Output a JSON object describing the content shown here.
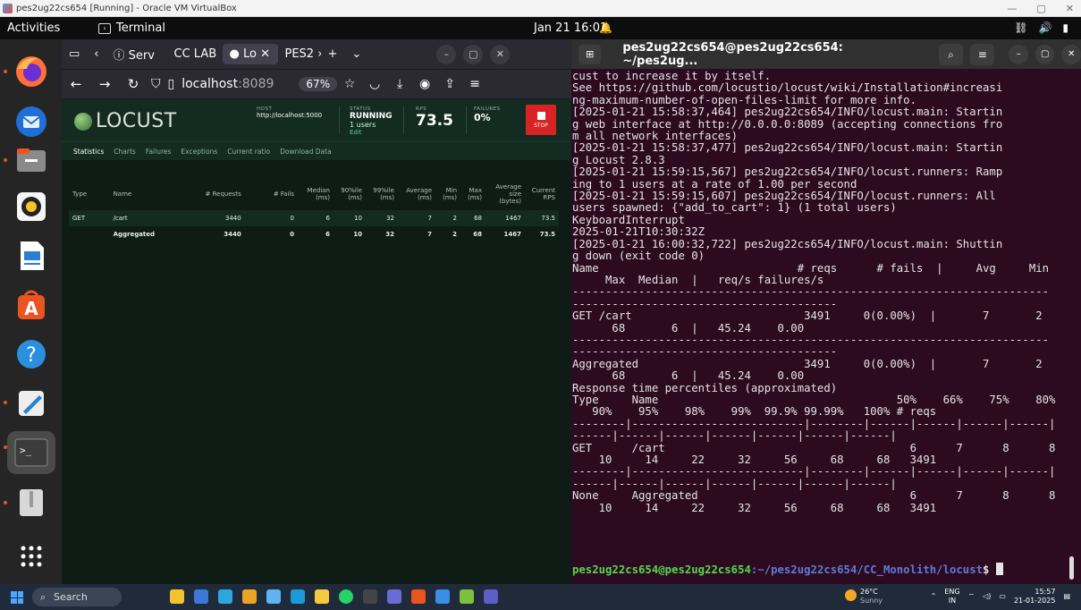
{
  "vbox": {
    "title": "pes2ug22cs654 [Running] - Oracle VM VirtualBox",
    "controls": [
      "—",
      "▢",
      "✕"
    ]
  },
  "topbar": {
    "activities": "Activities",
    "app": "Terminal",
    "clock": "Jan 21  16:01"
  },
  "firefox": {
    "tabs": [
      "Serv",
      "CC LAB",
      "Lo",
      "PES2"
    ],
    "url_host": "localhost",
    "url_port": ":8089",
    "zoom": "67%"
  },
  "locust": {
    "logo": "LOCUST",
    "host_label": "HOST",
    "host": "http://localhost:5000",
    "status_label": "STATUS",
    "status": "RUNNING",
    "users": "1 users",
    "edit": "Edit",
    "rps_label": "RPS",
    "rps": "73.5",
    "failures_label": "FAILURES",
    "failures": "0%",
    "stop": "STOP",
    "nav": [
      "Statistics",
      "Charts",
      "Failures",
      "Exceptions",
      "Current ratio",
      "Download Data"
    ],
    "columns": [
      "Type",
      "Name",
      "# Requests",
      "# Fails",
      "Median (ms)",
      "90%ile (ms)",
      "99%ile (ms)",
      "Average (ms)",
      "Min (ms)",
      "Max (ms)",
      "Average size (bytes)",
      "Current RPS"
    ],
    "rows": [
      [
        "GET",
        "/cart",
        "3440",
        "0",
        "6",
        "10",
        "32",
        "7",
        "2",
        "68",
        "1467",
        "73.5"
      ],
      [
        "",
        "Aggregated",
        "3440",
        "0",
        "6",
        "10",
        "32",
        "7",
        "2",
        "68",
        "1467",
        "73.5"
      ]
    ]
  },
  "terminal": {
    "title": "pes2ug22cs654@pes2ug22cs654: ~/pes2ug...",
    "lines": [
      "cust to increase it by itself.",
      "See https://github.com/locustio/locust/wiki/Installation#increasi",
      "ng-maximum-number-of-open-files-limit for more info.",
      "[2025-01-21 15:58:37,464] pes2ug22cs654/INFO/locust.main: Startin",
      "g web interface at http://0.0.0.0:8089 (accepting connections fro",
      "m all network interfaces)",
      "[2025-01-21 15:58:37,477] pes2ug22cs654/INFO/locust.main: Startin",
      "g Locust 2.8.3",
      "[2025-01-21 15:59:15,567] pes2ug22cs654/INFO/locust.runners: Ramp",
      "ing to 1 users at a rate of 1.00 per second",
      "[2025-01-21 15:59:15,607] pes2ug22cs654/INFO/locust.runners: All",
      "users spawned: {\"add_to_cart\": 1} (1 total users)",
      "KeyboardInterrupt",
      "2025-01-21T10:30:32Z",
      "[2025-01-21 16:00:32,722] pes2ug22cs654/INFO/locust.main: Shuttin",
      "g down (exit code 0)",
      "Name                              # reqs      # fails  |     Avg     Min",
      "     Max  Median  |   req/s failures/s",
      "------------------------------------------------------------------------",
      "----------------------------------------",
      "GET /cart                          3491     0(0.00%)  |       7       2",
      "      68       6  |   45.24    0.00",
      "------------------------------------------------------------------------",
      "----------------------------------------",
      "Aggregated                         3491     0(0.00%)  |       7       2",
      "      68       6  |   45.24    0.00",
      "",
      "Response time percentiles (approximated)",
      "Type     Name                                    50%    66%    75%    80%",
      "   90%    95%    98%    99%  99.9% 99.99%   100% # reqs",
      "--------|--------------------------|--------|------|------|------|------|",
      "------|------|------|------|------|------|------|",
      "GET      /cart                                     6      7      8      8",
      "    10     14     22     32     56     68     68   3491",
      "--------|--------------------------|--------|------|------|------|------|",
      "------|------|------|------|------|------|------|",
      "None     Aggregated                                6      7      8      8",
      "    10     14     22     32     56     68     68   3491"
    ],
    "prompt_user": "pes2ug22cs654@pes2ug22cs654",
    "prompt_path": ":~/pes2ug22cs654/CC_Monolith/locust",
    "prompt_sym": "$ "
  },
  "taskbar": {
    "search": "Search",
    "temp": "26°C",
    "weather": "Sunny",
    "lang1": "ENG",
    "lang2": "IN",
    "time": "15:57",
    "date": "21-01-2025"
  }
}
